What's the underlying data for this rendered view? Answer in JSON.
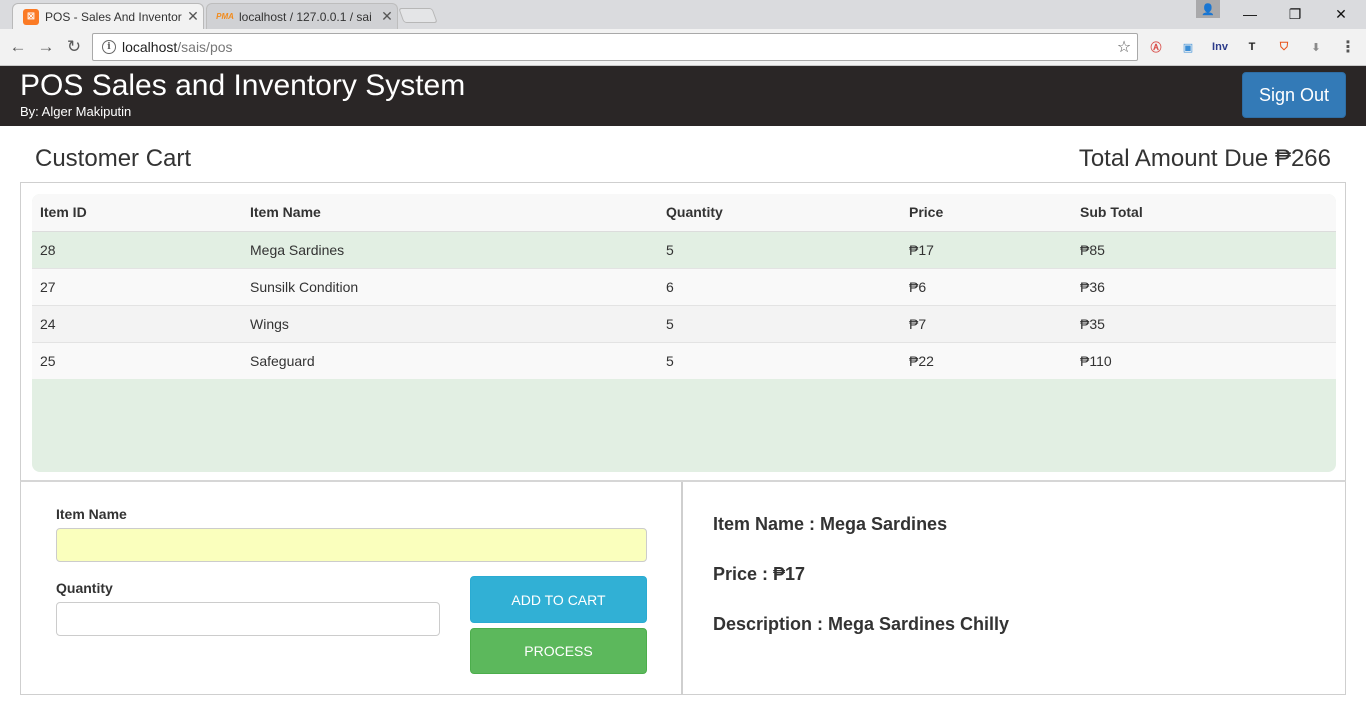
{
  "browser": {
    "tabs": [
      {
        "title": "POS - Sales And Inventor",
        "active": true,
        "favicon": "xampp-icon"
      },
      {
        "title": "localhost / 127.0.0.1 / sai",
        "active": false,
        "favicon": "phpmyadmin-icon"
      }
    ],
    "tab_favicon_text": {
      "xampp": "⊠",
      "pma": "PMA"
    },
    "close_glyph": "✕",
    "url_host": "localhost",
    "url_path": "/sais/pos",
    "info_glyph": "i",
    "star_glyph": "☆",
    "nav": {
      "back": "←",
      "forward": "→",
      "reload": "↻"
    },
    "window": {
      "minimize": "—",
      "restore": "❐",
      "close": "✕",
      "profile": "👤"
    },
    "extensions": [
      {
        "name": "adblock-icon",
        "glyph": "Ⓐ",
        "color": "#d9534f"
      },
      {
        "name": "capture-icon",
        "glyph": "▣",
        "color": "#3b8ed6"
      },
      {
        "name": "inv-extension-icon",
        "glyph": "Inv",
        "color": "#2b3a8a"
      },
      {
        "name": "translate-extension-icon",
        "glyph": "T",
        "color": "#222222"
      },
      {
        "name": "shield-extension-icon",
        "glyph": "⛉",
        "color": "#e8541c"
      },
      {
        "name": "download-arrow-icon",
        "glyph": "⬇",
        "color": "#8a8a8a"
      },
      {
        "name": "menu-icon",
        "glyph": "⋮",
        "color": "#555555"
      }
    ]
  },
  "header": {
    "title": "POS Sales and Inventory System",
    "subtitle": "By: Alger Makiputin",
    "signout_label": "Sign Out"
  },
  "cart": {
    "title": "Customer Cart",
    "total_label": "Total Amount Due ₱266",
    "columns": [
      "Item ID",
      "Item Name",
      "Quantity",
      "Price",
      "Sub Total"
    ],
    "rows": [
      [
        "28",
        "Mega Sardines",
        "5",
        "₱17",
        "₱85"
      ],
      [
        "27",
        "Sunsilk Condition",
        "6",
        "₱6",
        "₱36"
      ],
      [
        "24",
        "Wings",
        "5",
        "₱7",
        "₱35"
      ],
      [
        "25",
        "Safeguard",
        "5",
        "₱22",
        "₱110"
      ]
    ]
  },
  "form": {
    "item_name_label": "Item Name",
    "item_name_value": "",
    "quantity_label": "Quantity",
    "quantity_value": "",
    "add_to_cart_label": "ADD TO CART",
    "process_label": "PROCESS"
  },
  "details": {
    "item_name": "Item Name : Mega Sardines",
    "price": "Price : ₱17",
    "description": "Description : Mega Sardines Chilly"
  },
  "colors": {
    "header_bg": "#2a2626",
    "signout": "#337ab7",
    "add_to_cart": "#31b0d5",
    "process": "#5cb85c",
    "row_highlight": "#e2efe3",
    "autofill_input": "#faffbd"
  }
}
